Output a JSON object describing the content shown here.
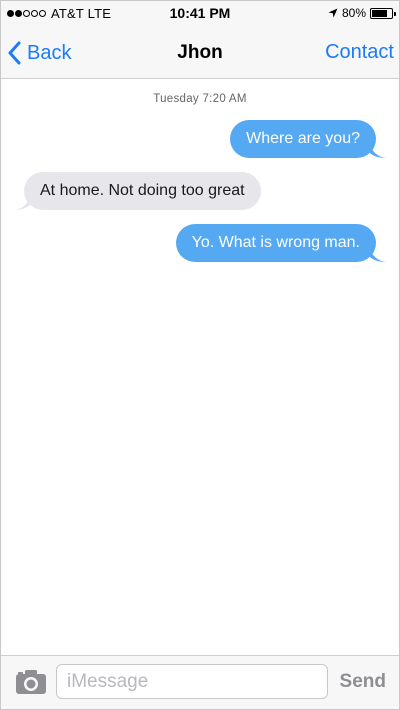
{
  "status_bar": {
    "signal_bars_filled": 2,
    "signal_bars_total": 5,
    "carrier": "AT&T LTE",
    "time": "10:41 PM",
    "battery_percent": "80%",
    "battery_level": 0.8,
    "location_icon": "location-arrow-icon"
  },
  "nav": {
    "back_label": "Back",
    "title": "Jhon",
    "contact_label": "Contact"
  },
  "conversation": {
    "timestamp": "Tuesday 7:20 AM",
    "messages": [
      {
        "direction": "sent",
        "text": "Where are you?"
      },
      {
        "direction": "received",
        "text": "At home. Not doing too great"
      },
      {
        "direction": "sent",
        "text": "Yo. What is wrong man."
      }
    ]
  },
  "input_bar": {
    "camera_icon": "camera-icon",
    "placeholder": "iMessage",
    "value": "",
    "send_label": "Send"
  },
  "colors": {
    "accent": "#1a7cf7",
    "sent_bubble": "#55a9f3",
    "received_bubble": "#e6e6eb"
  }
}
